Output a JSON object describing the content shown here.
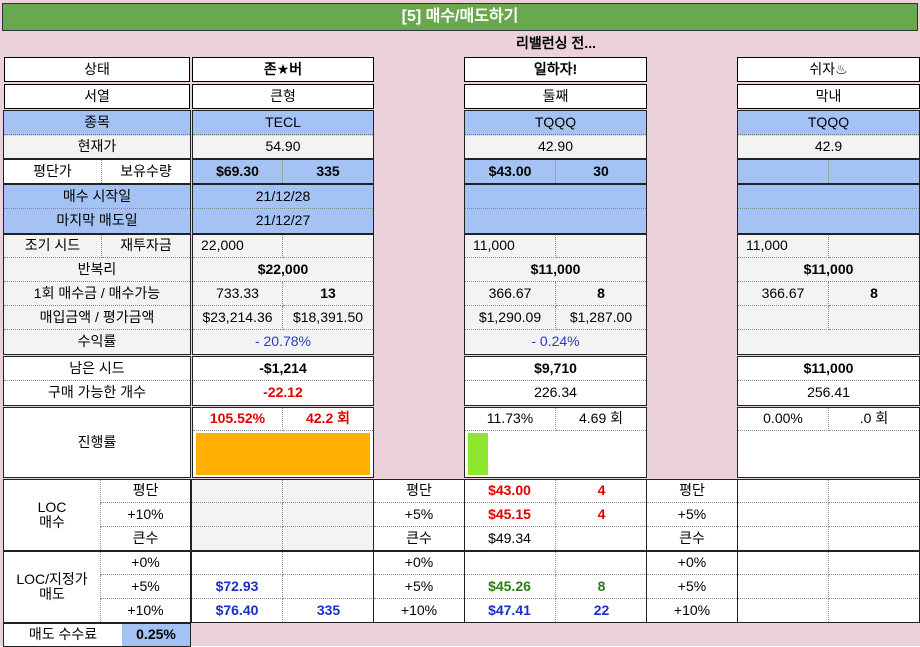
{
  "header": {
    "title": "[5] 매수/매도하기",
    "subtitle": "리밸런싱 전..."
  },
  "labels": {
    "status": "상태",
    "rank": "서열",
    "ticker": "종목",
    "price": "현재가",
    "avg": "평단가",
    "hold": "보유수량",
    "buy_start": "매수 시작일",
    "last_sell": "마지막 매도일",
    "seed": "조기 시드",
    "reinvest": "재투자금",
    "compound": "반복리",
    "per_buy": "1회 매수금 / 매수가능",
    "buy_eval": "매입금액 / 평가금액",
    "return": "수익률",
    "remain": "남은 시드",
    "buyable": "구매 가능한 개수",
    "progress": "진행률",
    "loc_buy": "LOC\n매수",
    "loc_sell": "LOC/지정가\n매도",
    "fee_label": "매도 수수료",
    "fee_value": "0.25%"
  },
  "loc_rows": {
    "buy_avg": "평단",
    "buy_10": "+10%",
    "buy_big": "큰수",
    "sell_0": "+0%",
    "sell_5": "+5%",
    "sell_10": "+10%"
  },
  "side_labels": {
    "b": {
      "r1": "평단",
      "r2": "+5%",
      "r3": "큰수",
      "r4": "+0%",
      "r5": "+5%",
      "r6": "+10%"
    },
    "c": {
      "r1": "평단",
      "r2": "+5%",
      "r3": "큰수",
      "r4": "+0%",
      "r5": "+5%",
      "r6": "+10%"
    }
  },
  "accounts": {
    "a": {
      "name": "존★버",
      "rank": "큰형",
      "ticker": "TECL",
      "price": "54.90",
      "avg": "$69.30",
      "qty": "335",
      "buy_start": "21/12/28",
      "last_sell": "21/12/27",
      "seed": "22,000",
      "reinvest": "",
      "compound": "$22,000",
      "per_buy": "733.33",
      "buyable_n": "13",
      "buy_amt": "$23,214.36",
      "eval_amt": "$18,391.50",
      "return": "- 20.78%",
      "remain": "-$1,214",
      "buyable": "-22.12",
      "progress_pct": "105.52%",
      "progress_cnt": "42.2 회",
      "progress_fill": 1.0,
      "progress_color": "#ffb000",
      "loc_avg_price": "",
      "loc_avg_qty": "",
      "loc_plus_price": "",
      "loc_plus_qty": "",
      "loc_big": "",
      "sell0_price": "",
      "sell0_qty": "",
      "sell5_price": "$72.93",
      "sell5_qty": "",
      "sell10_price": "$76.40",
      "sell10_qty": "335"
    },
    "b": {
      "name": "일하자!",
      "rank": "둘째",
      "ticker": "TQQQ",
      "price": "42.90",
      "avg": "$43.00",
      "qty": "30",
      "buy_start": "",
      "last_sell": "",
      "seed": "11,000",
      "reinvest": "",
      "compound": "$11,000",
      "per_buy": "366.67",
      "buyable_n": "8",
      "buy_amt": "$1,290.09",
      "eval_amt": "$1,287.00",
      "return": "- 0.24%",
      "remain": "$9,710",
      "buyable": "226.34",
      "progress_pct": "11.73%",
      "progress_cnt": "4.69 회",
      "progress_fill": 0.117,
      "progress_color": "#8ee62e",
      "loc_avg_price": "$43.00",
      "loc_avg_qty": "4",
      "loc_plus_price": "$45.15",
      "loc_plus_qty": "4",
      "loc_big": "$49.34",
      "sell0_price": "",
      "sell0_qty": "",
      "sell5_price": "$45.26",
      "sell5_qty": "8",
      "sell10_price": "$47.41",
      "sell10_qty": "22"
    },
    "c": {
      "name": "쉬자♨",
      "rank": "막내",
      "ticker": "TQQQ",
      "price": "42.9",
      "avg": "",
      "qty": "",
      "buy_start": "",
      "last_sell": "",
      "seed": "11,000",
      "reinvest": "",
      "compound": "$11,000",
      "per_buy": "366.67",
      "buyable_n": "8",
      "buy_amt": "",
      "eval_amt": "",
      "return": "",
      "remain": "$11,000",
      "buyable": "256.41",
      "progress_pct": "0.00%",
      "progress_cnt": ".0 회",
      "progress_fill": 0,
      "progress_color": "#ffffff"
    }
  }
}
